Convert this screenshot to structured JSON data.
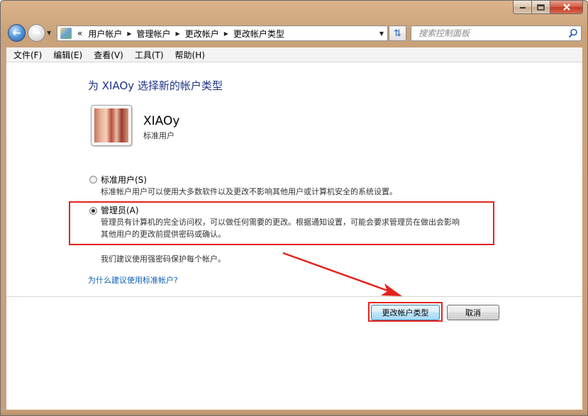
{
  "window": {
    "caption_buttons": [
      "minimize-icon",
      "maximize-icon",
      "close-icon"
    ]
  },
  "nav": {
    "address_prefix": "«",
    "breadcrumbs": [
      "用户帐户",
      "管理帐户",
      "更改帐户",
      "更改帐户类型"
    ],
    "search_placeholder": "搜索控制面板"
  },
  "menu": {
    "items": [
      "文件(F)",
      "编辑(E)",
      "查看(V)",
      "工具(T)",
      "帮助(H)"
    ]
  },
  "page": {
    "title": "为 XIAOy 选择新的帐户类型",
    "user": {
      "name": "XIAOy",
      "type": "标准用户"
    },
    "options": [
      {
        "label": "标准用户(S)",
        "description": "标准帐户用户可以使用大多数软件以及更改不影响其他用户或计算机安全的系统设置。",
        "selected": false
      },
      {
        "label": "管理员(A)",
        "description_line1": "管理员有计算机的完全访问权，可以做任何需要的更改。根据通知设置，可能会要求管理员在做出会影响",
        "description_line2": "其他用户的更改前提供密码或确认。",
        "selected": true
      }
    ],
    "recommendation": "我们建议使用强密码保护每个帐户。",
    "help_link": "为什么建议使用标准帐户?"
  },
  "buttons": {
    "change": "更改帐户类型",
    "cancel": "取消"
  },
  "colors": {
    "annotation_red": "#e5231d",
    "title_blue": "#1e3287",
    "link_blue": "#0b5fb5"
  }
}
